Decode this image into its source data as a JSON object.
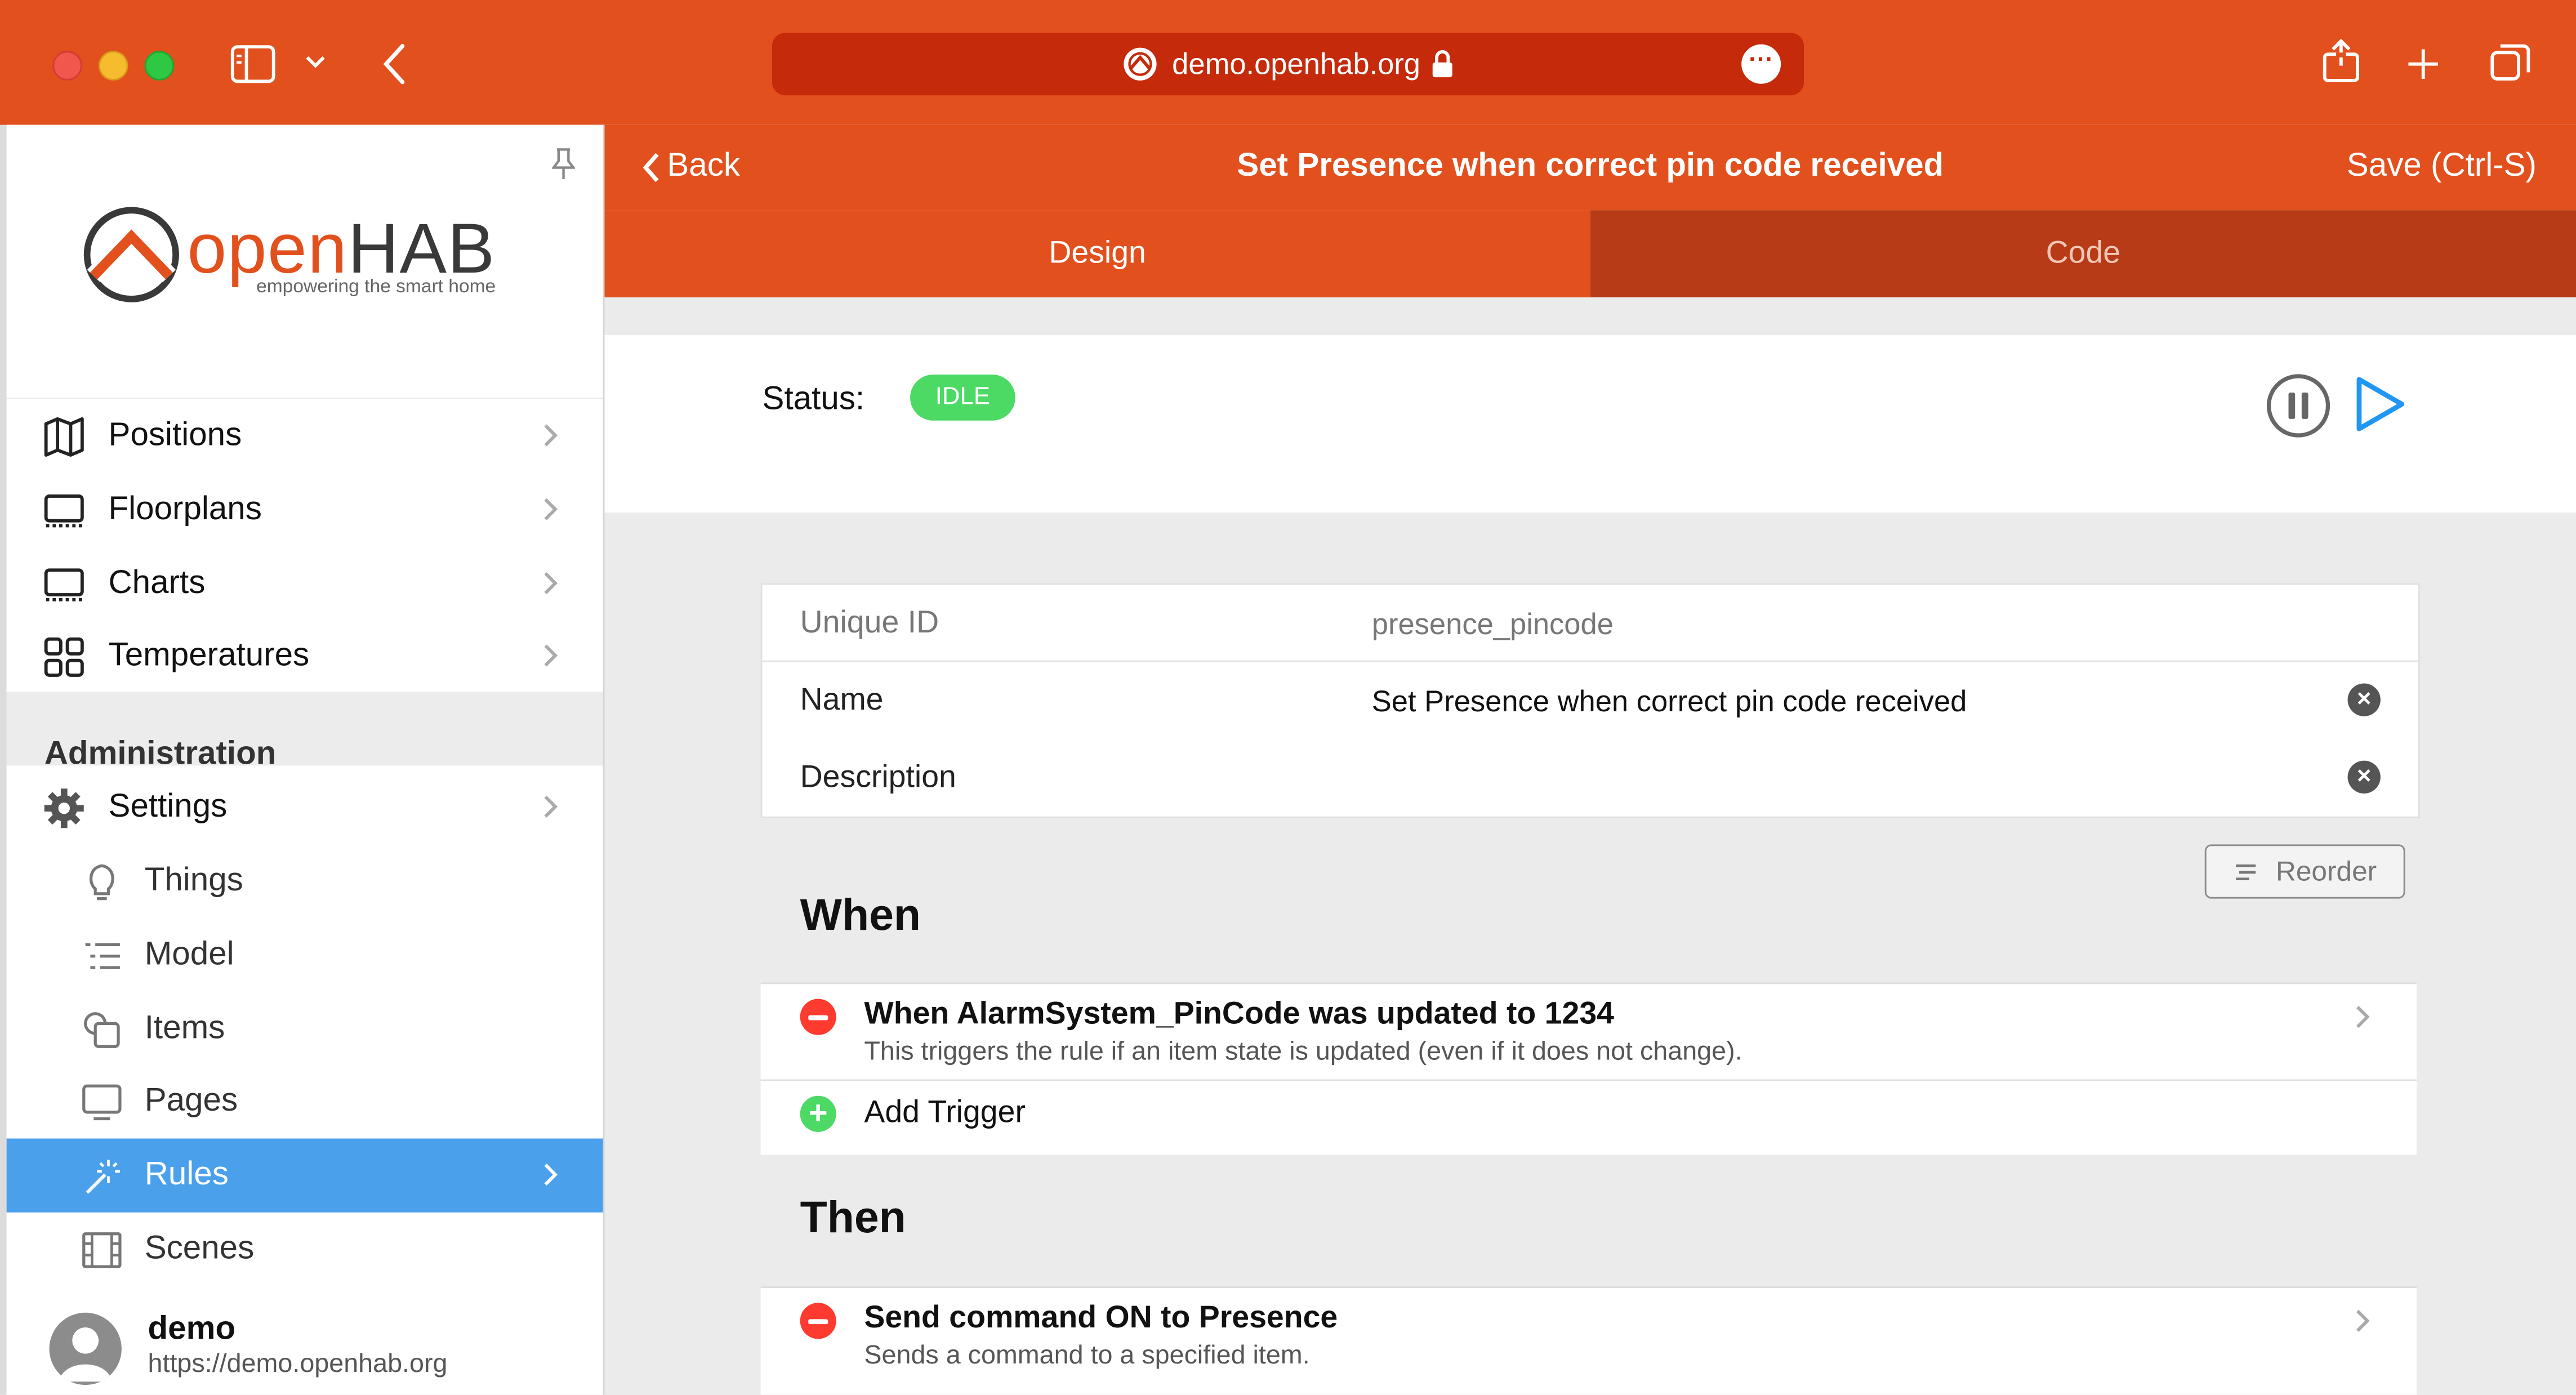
{
  "browser": {
    "url": "demo.openhab.org"
  },
  "brand": {
    "name_part1": "open",
    "name_part2": "HAB",
    "tagline": "empowering the smart home",
    "accent_color": "#e2501d",
    "active_color": "#4aa0ea"
  },
  "sidebar": {
    "items": [
      {
        "label": "Positions",
        "icon": "map-icon"
      },
      {
        "label": "Floorplans",
        "icon": "monitor-icon"
      },
      {
        "label": "Charts",
        "icon": "monitor-icon"
      },
      {
        "label": "Temperatures",
        "icon": "grid-icon"
      }
    ],
    "admin_heading": "Administration",
    "admin_items": [
      {
        "label": "Settings",
        "icon": "gear-icon"
      },
      {
        "label": "Things",
        "icon": "lightbulb-icon"
      },
      {
        "label": "Model",
        "icon": "list-icon"
      },
      {
        "label": "Items",
        "icon": "shapes-icon"
      },
      {
        "label": "Pages",
        "icon": "display-icon"
      },
      {
        "label": "Rules",
        "icon": "wand-icon",
        "active": true
      },
      {
        "label": "Scenes",
        "icon": "film-icon"
      }
    ],
    "user": {
      "name": "demo",
      "url": "https://demo.openhab.org"
    }
  },
  "header": {
    "back_label": "Back",
    "title": "Set Presence when correct pin code received",
    "save_label": "Save (Ctrl-S)"
  },
  "tabs": [
    {
      "label": "Design",
      "active": true
    },
    {
      "label": "Code",
      "active": false
    }
  ],
  "status": {
    "label": "Status:",
    "value": "IDLE"
  },
  "properties": {
    "uid_label": "Unique ID",
    "uid_value": "presence_pincode",
    "name_label": "Name",
    "name_value": "Set Presence when correct pin code received",
    "description_label": "Description",
    "description_value": ""
  },
  "reorder_label": "Reorder",
  "when": {
    "title": "When",
    "trigger_title": "When AlarmSystem_PinCode was updated to 1234",
    "trigger_desc": "This triggers the rule if an item state is updated (even if it does not change).",
    "add_label": "Add Trigger"
  },
  "then": {
    "title": "Then",
    "action_title": "Send command ON to Presence",
    "action_desc": "Sends a command to a specified item."
  }
}
